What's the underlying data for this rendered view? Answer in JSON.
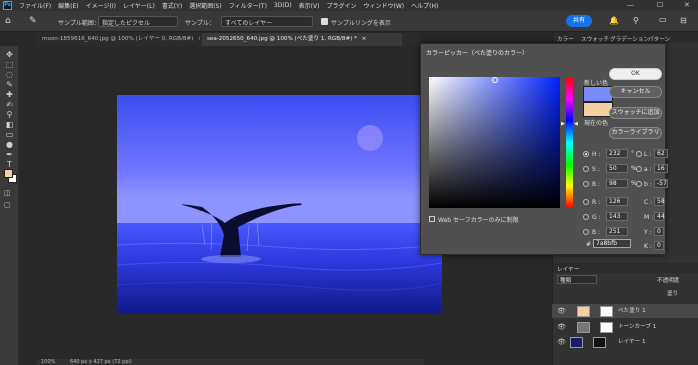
{
  "menubar": {
    "logo": "Ps",
    "items": [
      "ファイル(F)",
      "編集(E)",
      "イメージ(I)",
      "レイヤー(L)",
      "書式(Y)",
      "選択範囲(S)",
      "フィルター(T)",
      "3D(D)",
      "表示(V)",
      "プラグイン",
      "ウィンドウ(W)",
      "ヘルプ(H)"
    ],
    "min_glyph": "—",
    "max_glyph": "☐",
    "close_glyph": "✕"
  },
  "options": {
    "sample_size_label": "サンプル範囲：",
    "sample_size_value": "指定したピクセル",
    "sample_label": "サンプル：",
    "sample_value": "すべてのレイヤー",
    "show_ring_label": "サンプルリングを表示",
    "share_label": "共有"
  },
  "tabs": [
    {
      "label": "moon-1859616_640.jpg @ 100% (レイヤー 0, RGB/8#)",
      "close": "×"
    },
    {
      "label": "sea-2052650_640.jpg @ 100% (べた塗り 1, RGB/8#) *",
      "close": "×"
    }
  ],
  "status": {
    "zoom": "100%",
    "dims": "640 px x 427 px (72 ppi)"
  },
  "tools": [
    "move-icon",
    "marquee-icon",
    "lasso-icon",
    "eyedropper-icon",
    "healing-icon",
    "brush-icon",
    "stamp-icon",
    "eraser-icon",
    "gradient-icon",
    "dodge-icon",
    "pen-icon",
    "text-icon",
    "path-select-icon",
    "ellipse-icon",
    "hand-icon",
    "zoom-icon",
    "more-icon"
  ],
  "tool_glyphs": [
    "✥",
    "⬚",
    "◌",
    "✎",
    "✚",
    "✍",
    "⚲",
    "◧",
    "▭",
    "●",
    "✒",
    "T",
    "➤",
    "◯",
    "✋",
    "⚲",
    "⋯"
  ],
  "colors": {
    "foreground": "#f3cfa3",
    "background": "#ffffff",
    "picker_new": "#7a8bfb",
    "picker_current": "#f3cfa3"
  },
  "picker": {
    "title": "カラーピッカー（べた塗りのカラー）",
    "new_label": "新しい色",
    "current_label": "現在の色",
    "ok": "OK",
    "cancel": "キャンセル",
    "add_swatch": "スウォッチに追加",
    "libraries": "カラーライブラリ",
    "web_only": "Web セーフカラーのみに制限",
    "fields": {
      "H": "232",
      "S": "50",
      "B": "98",
      "R": "126",
      "G": "143",
      "B2": "251",
      "L": "62",
      "a": "16",
      "b": "-57",
      "C": "58",
      "M": "44",
      "Y": "0",
      "K": "0"
    },
    "hex_label": "#",
    "hex": "7a8bfb",
    "units": {
      "deg": "°",
      "pct": "%"
    }
  },
  "panels": {
    "tabs": [
      "カラー",
      "スウォッチ",
      "グラデーション",
      "パターン"
    ],
    "layers_tab": "レイヤー",
    "opacity_label": "不透明度",
    "fill_label": "塗り",
    "search_label": "種類",
    "layers": [
      {
        "name": "べた塗り 1"
      },
      {
        "name": "トーンカーブ 1"
      },
      {
        "name": "レイヤー 1"
      }
    ]
  }
}
